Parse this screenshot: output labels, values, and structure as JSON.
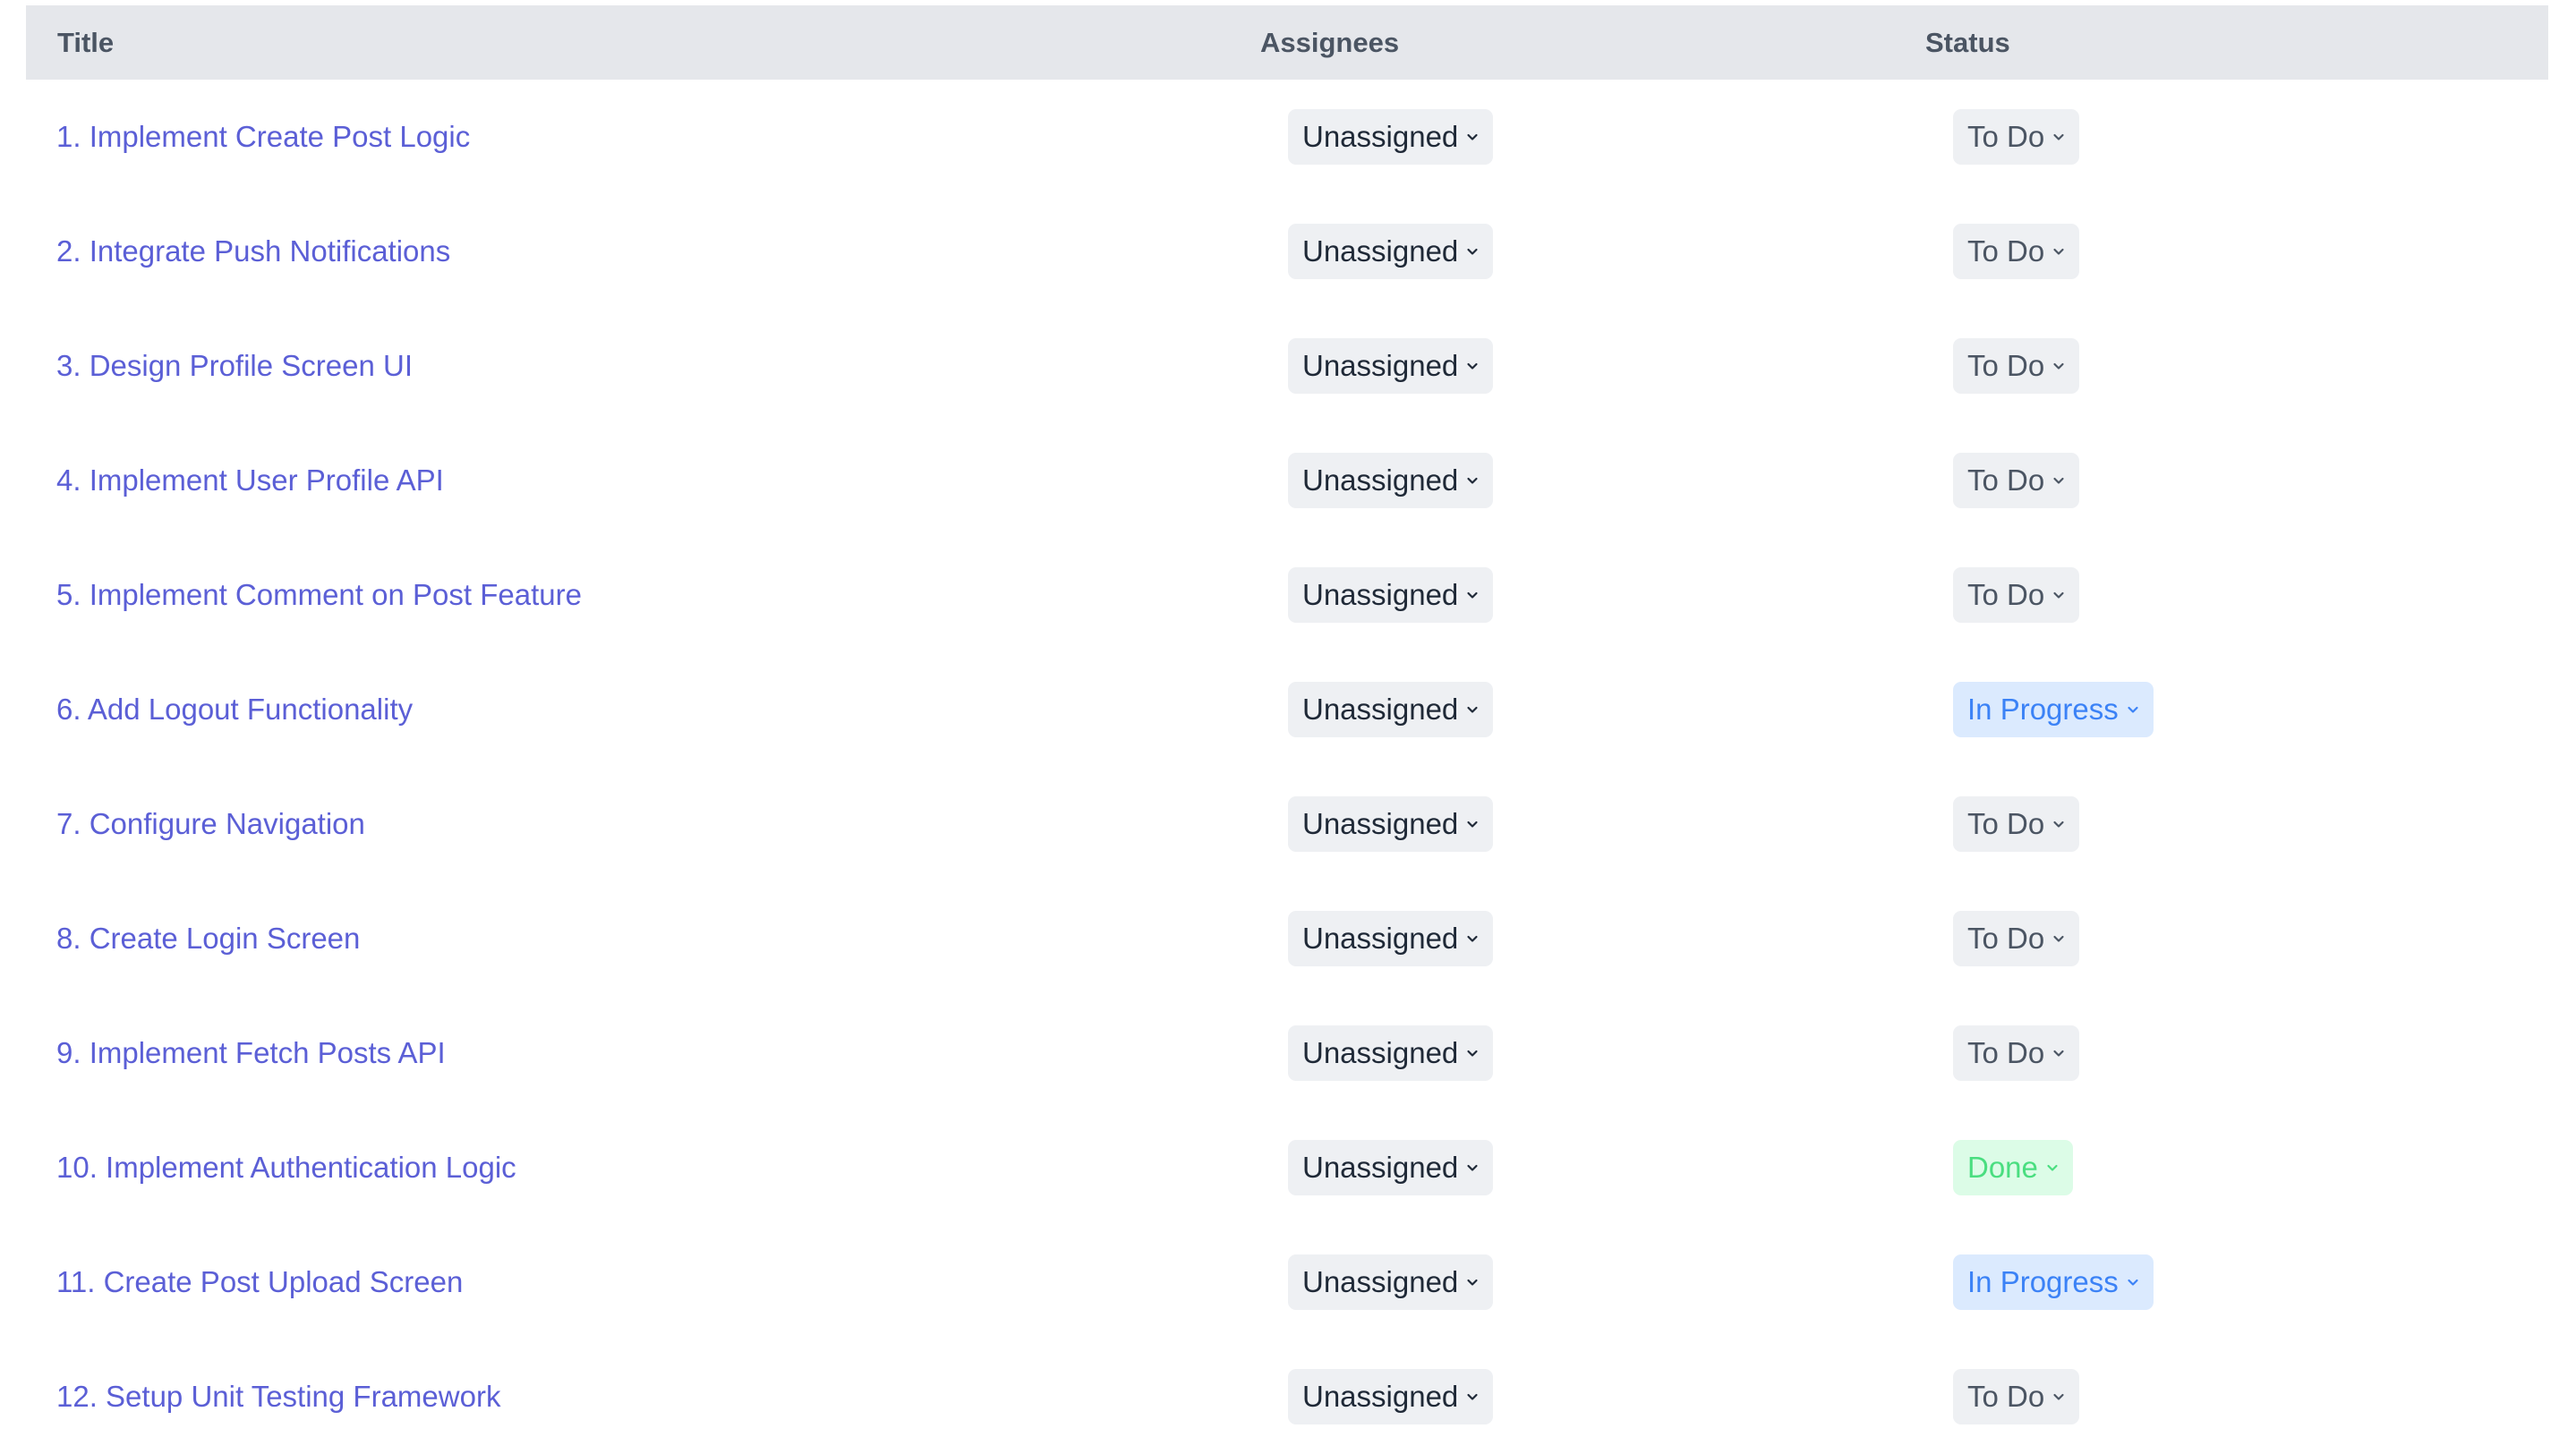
{
  "table": {
    "headers": {
      "title": "Title",
      "assignees": "Assignees",
      "status": "Status"
    },
    "rows": [
      {
        "title": "1. Implement Create Post Logic",
        "assignee": "Unassigned",
        "status": "To Do",
        "status_kind": "todo"
      },
      {
        "title": "2. Integrate Push Notifications",
        "assignee": "Unassigned",
        "status": "To Do",
        "status_kind": "todo"
      },
      {
        "title": "3. Design Profile Screen UI",
        "assignee": "Unassigned",
        "status": "To Do",
        "status_kind": "todo"
      },
      {
        "title": "4. Implement User Profile API",
        "assignee": "Unassigned",
        "status": "To Do",
        "status_kind": "todo"
      },
      {
        "title": "5. Implement Comment on Post Feature",
        "assignee": "Unassigned",
        "status": "To Do",
        "status_kind": "todo"
      },
      {
        "title": "6. Add Logout Functionality",
        "assignee": "Unassigned",
        "status": "In Progress",
        "status_kind": "inprogress"
      },
      {
        "title": "7. Configure Navigation",
        "assignee": "Unassigned",
        "status": "To Do",
        "status_kind": "todo"
      },
      {
        "title": "8. Create Login Screen",
        "assignee": "Unassigned",
        "status": "To Do",
        "status_kind": "todo"
      },
      {
        "title": "9. Implement Fetch Posts API",
        "assignee": "Unassigned",
        "status": "To Do",
        "status_kind": "todo"
      },
      {
        "title": "10. Implement Authentication Logic",
        "assignee": "Unassigned",
        "status": "Done",
        "status_kind": "done"
      },
      {
        "title": "11. Create Post Upload Screen",
        "assignee": "Unassigned",
        "status": "In Progress",
        "status_kind": "inprogress"
      },
      {
        "title": "12. Setup Unit Testing Framework",
        "assignee": "Unassigned",
        "status": "To Do",
        "status_kind": "todo"
      }
    ]
  },
  "icons": {
    "dropdown": "chevron-down-icon"
  },
  "colors": {
    "header_bg": "#e5e7eb",
    "link": "#5b5fd6",
    "todo_bg": "#eef0f3",
    "inprogress_bg": "#dbeafe",
    "inprogress_text": "#3b82f6",
    "done_bg": "#dcfce7",
    "done_text": "#4ade80"
  }
}
